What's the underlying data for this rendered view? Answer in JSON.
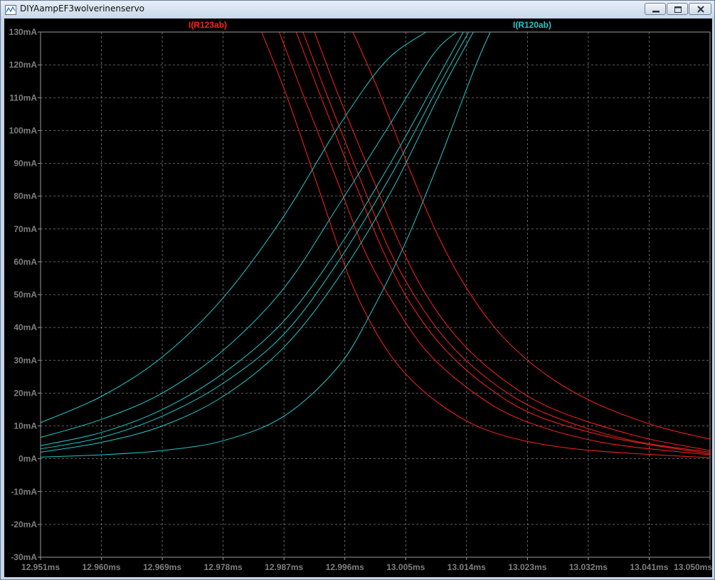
{
  "window": {
    "title": "DIYAampEF3wolverinenservo",
    "controls": {
      "minimize": "minimize",
      "maximize": "maximize",
      "close": "close"
    }
  },
  "chart_data": {
    "type": "line",
    "title": "",
    "xlabel": "",
    "ylabel": "",
    "grid": true,
    "x_unit": "ms",
    "y_unit": "mA",
    "xlim": [
      12.951,
      13.05
    ],
    "ylim": [
      -30,
      130
    ],
    "x_ticks": [
      "12.951ms",
      "12.960ms",
      "12.969ms",
      "12.978ms",
      "12.987ms",
      "12.996ms",
      "13.005ms",
      "13.014ms",
      "13.023ms",
      "13.032ms",
      "13.041ms",
      "13.050ms"
    ],
    "y_ticks": [
      "130mA",
      "120mA",
      "110mA",
      "100mA",
      "90mA",
      "80mA",
      "70mA",
      "60mA",
      "50mA",
      "40mA",
      "30mA",
      "20mA",
      "10mA",
      "0mA",
      "-10mA",
      "-20mA",
      "-30mA"
    ],
    "legend": [
      {
        "name": "I(R123ab)",
        "color": "#ff2020"
      },
      {
        "name": "I(R120ab)",
        "color": "#20c8c8"
      }
    ],
    "series": [
      {
        "name": "I(R123ab)",
        "color": "#ff2020",
        "traces": [
          {
            "x": [
              12.9837,
              12.9875,
              12.9925,
              12.9965,
              13.0002,
              13.0045,
              13.0105,
              13.018,
              13.03,
              13.05
            ],
            "y": [
              130,
              110,
              80,
              56,
              40,
              27,
              16,
              8,
              3,
              0.3
            ]
          },
          {
            "x": [
              12.9863,
              12.99,
              12.995,
              12.999,
              13.003,
              13.008,
              13.0145,
              13.022,
              13.034,
              13.05
            ],
            "y": [
              130,
              110,
              84,
              63,
              48,
              33,
              21,
              12,
              5,
              1.2
            ]
          },
          {
            "x": [
              12.9888,
              12.9925,
              12.9975,
              13.0015,
              13.0055,
              13.0105,
              13.017,
              13.0245,
              13.0365,
              13.05
            ],
            "y": [
              130,
              110,
              84,
              64,
              48,
              34,
              22,
              13,
              6,
              1.5
            ]
          },
          {
            "x": [
              12.9898,
              12.9935,
              12.9985,
              13.0025,
              13.0065,
              13.0115,
              13.018,
              13.0255,
              13.0375,
              13.05
            ],
            "y": [
              130,
              110,
              84,
              64,
              49,
              35,
              23,
              14,
              6,
              2
            ]
          },
          {
            "x": [
              12.9915,
              12.995,
              13.0,
              13.004,
              13.008,
              13.013,
              13.0195,
              13.027,
              13.039,
              13.05
            ],
            "y": [
              130,
              111,
              86,
              66,
              50,
              36,
              24,
              15,
              7,
              2.5
            ]
          },
          {
            "x": [
              12.9972,
              13.001,
              13.006,
              13.01,
              13.014,
              13.019,
              13.0255,
              13.033,
              13.042,
              13.05
            ],
            "y": [
              130,
              112,
              86,
              67,
              52,
              38,
              26,
              17,
              10,
              6
            ]
          }
        ]
      },
      {
        "name": "I(R120ab)",
        "color": "#20c8c8",
        "traces": [
          {
            "x": [
              12.951,
              12.96,
              12.969,
              12.978,
              12.987,
              12.995,
              13.002,
              13.008
            ],
            "y": [
              11,
              19,
              31,
              49,
              74,
              101,
              121,
              130
            ]
          },
          {
            "x": [
              12.951,
              12.96,
              12.969,
              12.978,
              12.987,
              12.995,
              13.003,
              13.009,
              13.0125
            ],
            "y": [
              6.5,
              12,
              20,
              33,
              52,
              77,
              103,
              123,
              130
            ]
          },
          {
            "x": [
              12.951,
              12.96,
              12.969,
              12.978,
              12.987,
              12.995,
              13.003,
              13.01,
              13.0135
            ],
            "y": [
              4,
              8,
              15,
              26,
              42,
              64,
              91,
              117,
              130
            ]
          },
          {
            "x": [
              12.951,
              12.96,
              12.969,
              12.978,
              12.987,
              12.995,
              13.003,
              13.01,
              13.0143
            ],
            "y": [
              3,
              6.5,
              13,
              23,
              38,
              60,
              87,
              114,
              130
            ]
          },
          {
            "x": [
              12.951,
              12.96,
              12.969,
              12.978,
              12.987,
              12.995,
              13.003,
              13.01,
              13.015
            ],
            "y": [
              2,
              5,
              10,
              19,
              34,
              55,
              82,
              111,
              130
            ]
          },
          {
            "x": [
              12.951,
              12.96,
              12.969,
              12.978,
              12.987,
              12.995,
              13.0,
              13.005,
              13.01,
              13.015,
              13.0175
            ],
            "y": [
              0.5,
              1.2,
              2.5,
              5.5,
              13,
              28,
              45,
              66,
              91,
              118,
              130
            ]
          }
        ]
      }
    ]
  }
}
